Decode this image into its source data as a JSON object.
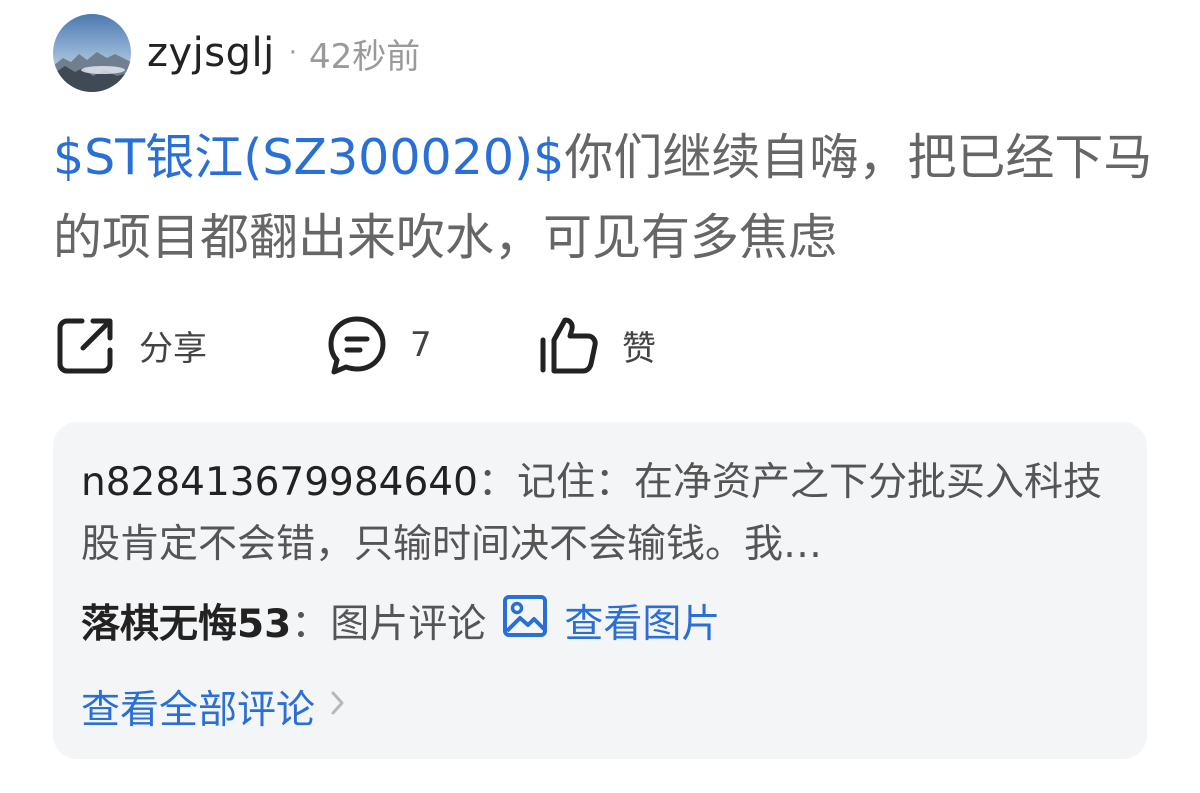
{
  "post": {
    "author": "zyjsglj",
    "separator": "·",
    "time": "42秒前",
    "stock_tag": "$ST银江(SZ300020)$",
    "text": "你们继续自嗨，把已经下马的项目都翻出来吹水，可见有多焦虑"
  },
  "actions": {
    "share": {
      "icon": "share-icon",
      "label": "分享"
    },
    "comment": {
      "icon": "comment-bubble-icon",
      "count": "7"
    },
    "like": {
      "icon": "thumbs-up-icon",
      "label": "赞"
    }
  },
  "comments": {
    "items": [
      {
        "author": "n828413679984640",
        "separator": "：",
        "text": "记住：在净资产之下分批买入科技股肯定不会错，只输时间决不会输钱。我…"
      },
      {
        "author": "落棋无悔53",
        "separator": "：",
        "text": "图片评论",
        "link_icon": "image-icon",
        "link_label": "查看图片"
      }
    ],
    "view_all_label": "查看全部评论",
    "view_all_icon": "chevron-right-icon"
  },
  "colors": {
    "link_blue": "#2a6fd6",
    "body_text": "#666666",
    "muted": "#9a9a9a",
    "comment_bg": "#f4f5f7"
  }
}
